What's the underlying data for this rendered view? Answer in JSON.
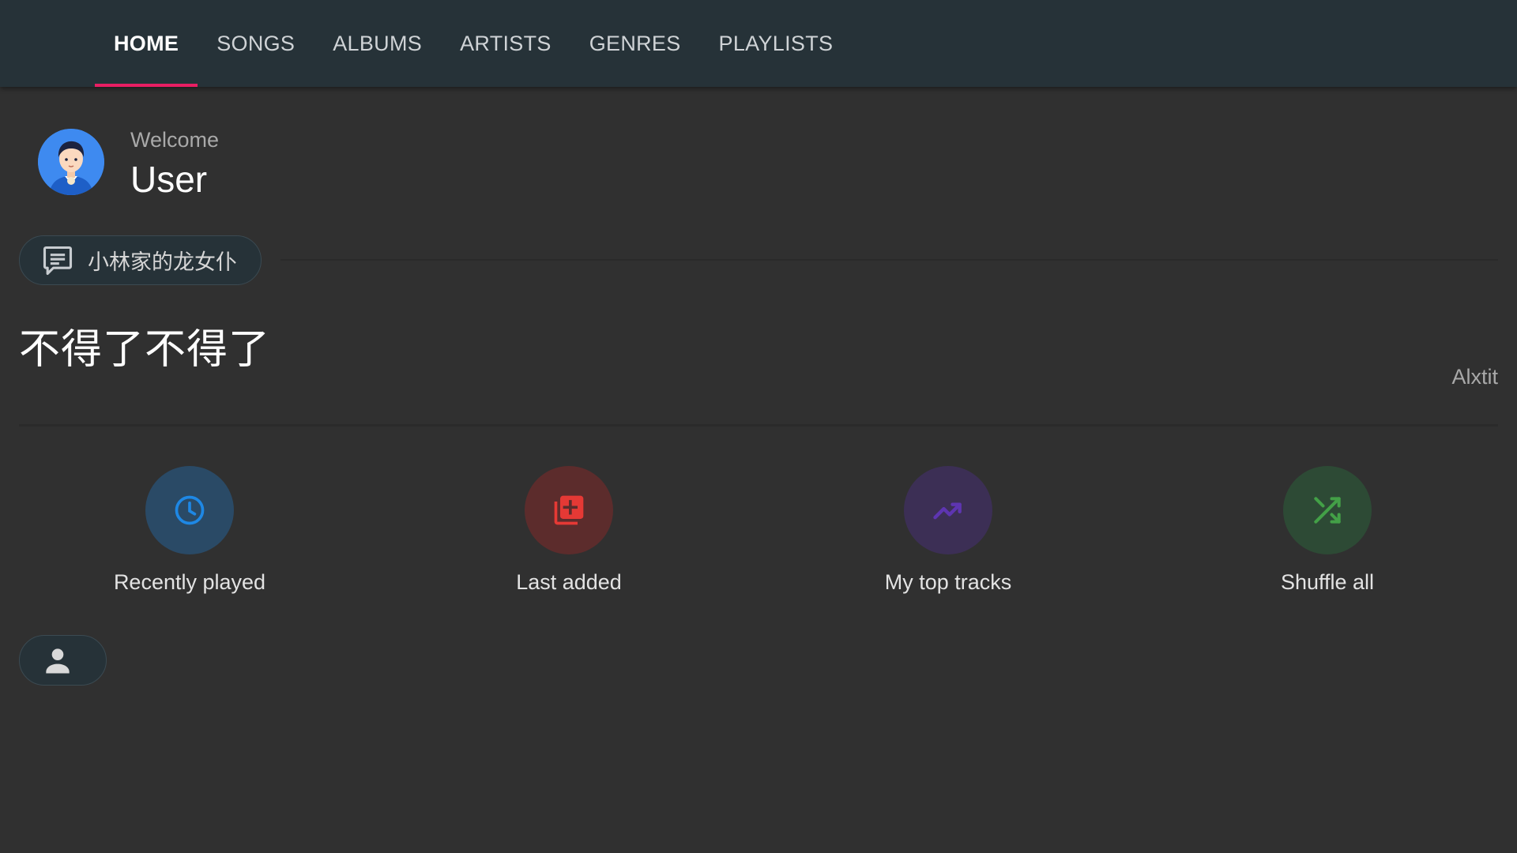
{
  "tabs": [
    {
      "label": "HOME",
      "active": true
    },
    {
      "label": "SONGS",
      "active": false
    },
    {
      "label": "ALBUMS",
      "active": false
    },
    {
      "label": "ARTISTS",
      "active": false
    },
    {
      "label": "GENRES",
      "active": false
    },
    {
      "label": "PLAYLISTS",
      "active": false
    }
  ],
  "welcome": {
    "label": "Welcome",
    "name": "User"
  },
  "song_chip": {
    "title": "小林家的龙女仆",
    "icon": "message-icon"
  },
  "lyric": {
    "text": "不得了不得了",
    "author": "Alxtit"
  },
  "actions": [
    {
      "label": "Recently played",
      "icon": "clock-icon",
      "circle_color": "#2a4a66",
      "icon_color": "#1e88e5"
    },
    {
      "label": "Last added",
      "icon": "library-add-icon",
      "circle_color": "#5c2c2c",
      "icon_color": "#e53935"
    },
    {
      "label": "My top tracks",
      "icon": "trending-up-icon",
      "circle_color": "#3c2f55",
      "icon_color": "#5e35b1"
    },
    {
      "label": "Shuffle all",
      "icon": "shuffle-icon",
      "circle_color": "#2d4a35",
      "icon_color": "#43a047"
    }
  ],
  "colors": {
    "accent": "#e91e63",
    "toolbar": "#263238",
    "background": "#303030"
  },
  "user_chip": {
    "icon": "person-icon"
  }
}
